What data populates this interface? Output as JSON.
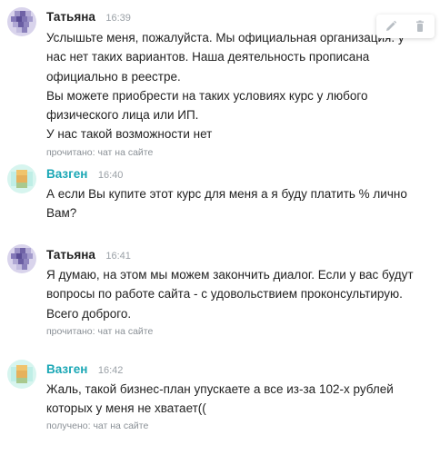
{
  "messages": [
    {
      "author": "Татьяна",
      "time": "16:39",
      "lines": [
        "Услышьте меня, пожалуйста. Мы официальная организация. у",
        "нас нет таких вариантов. Наша деятельность прописана",
        "официально в реестре.",
        "Вы можете приобрести на таких условиях курс у любого",
        "физического лица или ИП.",
        "У нас такой возможности нет"
      ],
      "status": "прочитано: чат на сайте"
    },
    {
      "author": "Вазген",
      "time": "16:40",
      "lines": [
        "А если Вы купите этот курс для меня а я буду платить % лично",
        "Вам?"
      ],
      "status": ""
    },
    {
      "author": "Татьяна",
      "time": "16:41",
      "lines": [
        "Я думаю, на этом мы можем закончить диалог. Если у вас будут",
        "вопросы по работе сайта - с удовольствием проконсультирую.",
        "Всего доброго."
      ],
      "status": "прочитано: чат на сайте"
    },
    {
      "author": "Вазген",
      "time": "16:42",
      "lines": [
        "Жаль, такой бизнес-план упускаете а все из-за 102-х рублей",
        "которых у меня не хватает(("
      ],
      "status": "получено: чат на сайте"
    }
  ],
  "actions": {
    "edit_icon": "pencil-icon",
    "delete_icon": "trash-icon"
  },
  "colors": {
    "operator_name": "#222222",
    "visitor_name": "#1aa7b5",
    "meta_text": "#9aa0a6",
    "operator_avatar": "#6f62a6",
    "visitor_avatar_fill": "#e6b15c",
    "visitor_avatar_tint": "#bfeee6"
  }
}
